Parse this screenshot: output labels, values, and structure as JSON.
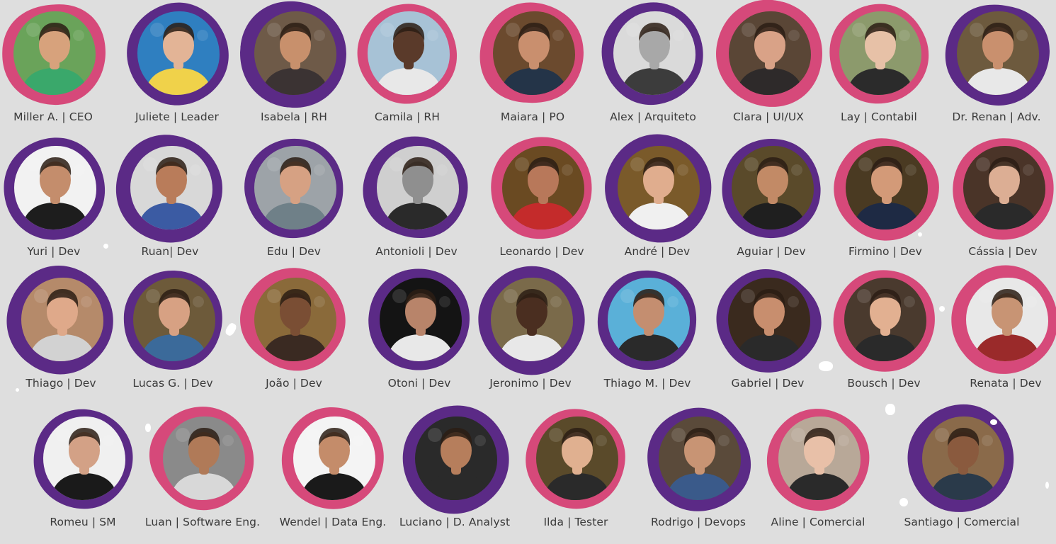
{
  "colors": {
    "purple": "#5b2a86",
    "pink": "#d6497a",
    "background": "#dedede",
    "text": "#3a3a3a"
  },
  "members": [
    {
      "name": "Miller A. | CEO",
      "blob": "pink",
      "skin": "#d7a27c",
      "bg": "#6aa35a",
      "shirt": "#3aa86b"
    },
    {
      "name": "Juliete | Leader",
      "blob": "purple",
      "skin": "#e3b496",
      "bg": "#2f7fc0",
      "shirt": "#f0d24a"
    },
    {
      "name": "Isabela | RH",
      "blob": "purple",
      "skin": "#c8906c",
      "bg": "#6e5a48",
      "shirt": "#3b3333"
    },
    {
      "name": "Camila | RH",
      "blob": "pink",
      "skin": "#5a3a2a",
      "bg": "#a7c2d6",
      "shirt": "#e8e8e8"
    },
    {
      "name": "Maiara | PO",
      "blob": "pink",
      "skin": "#c98f6e",
      "bg": "#6b4a2e",
      "shirt": "#243448"
    },
    {
      "name": "Alex | Arquiteto",
      "blob": "purple",
      "skin": "#a8a8a8",
      "bg": "#dadada",
      "shirt": "#3c3c3c"
    },
    {
      "name": "Clara | UI/UX",
      "blob": "pink",
      "skin": "#d9a287",
      "bg": "#5a4636",
      "shirt": "#2e2a2a"
    },
    {
      "name": "Lay | Contabil",
      "blob": "pink",
      "skin": "#e7c1a7",
      "bg": "#8c9a6c",
      "shirt": "#2b2b2b"
    },
    {
      "name": "Dr. Renan | Adv.",
      "blob": "purple",
      "skin": "#c9906e",
      "bg": "#6d5a3e",
      "shirt": "#e8e8e8"
    },
    {
      "name": "Yuri | Dev",
      "blob": "purple",
      "skin": "#c48d6c",
      "bg": "#f2f2f2",
      "shirt": "#1d1d1d"
    },
    {
      "name": "Ruan| Dev",
      "blob": "purple",
      "skin": "#b97c5a",
      "bg": "#d8d8d8",
      "shirt": "#3b5ba3"
    },
    {
      "name": "Edu | Dev",
      "blob": "purple",
      "skin": "#d6a183",
      "bg": "#9da3a8",
      "shirt": "#6f8088"
    },
    {
      "name": "Antonioli | Dev",
      "blob": "purple",
      "skin": "#8f8f8f",
      "bg": "#cfcfcf",
      "shirt": "#2a2a2a"
    },
    {
      "name": "Leonardo | Dev",
      "blob": "pink",
      "skin": "#b8785a",
      "bg": "#6a4a22",
      "shirt": "#c42b2b"
    },
    {
      "name": "André | Dev",
      "blob": "purple",
      "skin": "#e0ad8e",
      "bg": "#7a5a2a",
      "shirt": "#f0f0f0"
    },
    {
      "name": "Aguiar | Dev",
      "blob": "purple",
      "skin": "#c28a66",
      "bg": "#5a4a2a",
      "shirt": "#1f1f1f"
    },
    {
      "name": "Firmino | Dev",
      "blob": "pink",
      "skin": "#d39a78",
      "bg": "#4a3a22",
      "shirt": "#1e2a44"
    },
    {
      "name": "Cássia | Dev",
      "blob": "pink",
      "skin": "#dcae94",
      "bg": "#4a3428",
      "shirt": "#2a2a2a"
    },
    {
      "name": "Thiago | Dev",
      "blob": "purple",
      "skin": "#dfa98a",
      "bg": "#b58a6a",
      "shirt": "#d2d2d2"
    },
    {
      "name": "Lucas G. | Dev",
      "blob": "purple",
      "skin": "#d7a183",
      "bg": "#6d5a3a",
      "shirt": "#3b6a9a"
    },
    {
      "name": "João | Dev",
      "blob": "pink",
      "skin": "#7a4e34",
      "bg": "#8a6a3a",
      "shirt": "#3a2a22"
    },
    {
      "name": "Otoni | Dev",
      "blob": "purple",
      "skin": "#b8846a",
      "bg": "#141414",
      "shirt": "#e8e8e8"
    },
    {
      "name": "Jeronimo | Dev",
      "blob": "purple",
      "skin": "#4a2e20",
      "bg": "#7a6a4a",
      "shirt": "#e8e8e8"
    },
    {
      "name": "Thiago M. | Dev",
      "blob": "purple",
      "skin": "#c48e70",
      "bg": "#5ab0d8",
      "shirt": "#2a2a2a"
    },
    {
      "name": "Gabriel | Dev",
      "blob": "purple",
      "skin": "#c88e6e",
      "bg": "#3a2a1e",
      "shirt": "#2a2a2a"
    },
    {
      "name": "Bousch | Dev",
      "blob": "pink",
      "skin": "#e2b091",
      "bg": "#4a3a2e",
      "shirt": "#2a2a2a"
    },
    {
      "name": "Renata | Dev",
      "blob": "pink",
      "skin": "#c89474",
      "bg": "#e8e8e8",
      "shirt": "#9a2a2a"
    },
    {
      "name": "Romeu | SM",
      "blob": "purple",
      "skin": "#d3a186",
      "bg": "#f0f0f0",
      "shirt": "#1a1a1a"
    },
    {
      "name": "Luan | Software Eng.",
      "blob": "pink",
      "skin": "#b07a58",
      "bg": "#8a8a8a",
      "shirt": "#d8d8d8"
    },
    {
      "name": "Wendel | Data Eng.",
      "blob": "pink",
      "skin": "#c48c6a",
      "bg": "#f4f4f4",
      "shirt": "#1a1a1a"
    },
    {
      "name": "Luciano | D. Analyst",
      "blob": "purple",
      "skin": "#b67e5c",
      "bg": "#2a2a2a",
      "shirt": "#2a2a2a"
    },
    {
      "name": "Ilda | Tester",
      "blob": "pink",
      "skin": "#e0b090",
      "bg": "#5a4a2a",
      "shirt": "#2a2a2a"
    },
    {
      "name": "Rodrigo | Devops",
      "blob": "purple",
      "skin": "#c89474",
      "bg": "#5a4a3a",
      "shirt": "#3a5a8a"
    },
    {
      "name": "Aline | Comercial",
      "blob": "pink",
      "skin": "#e8c0a8",
      "bg": "#b8a898",
      "shirt": "#2a2a2a"
    },
    {
      "name": "Santiago | Comercial",
      "blob": "purple",
      "skin": "#8a5a3e",
      "bg": "#8a6a4a",
      "shirt": "#2a3a4a"
    }
  ]
}
